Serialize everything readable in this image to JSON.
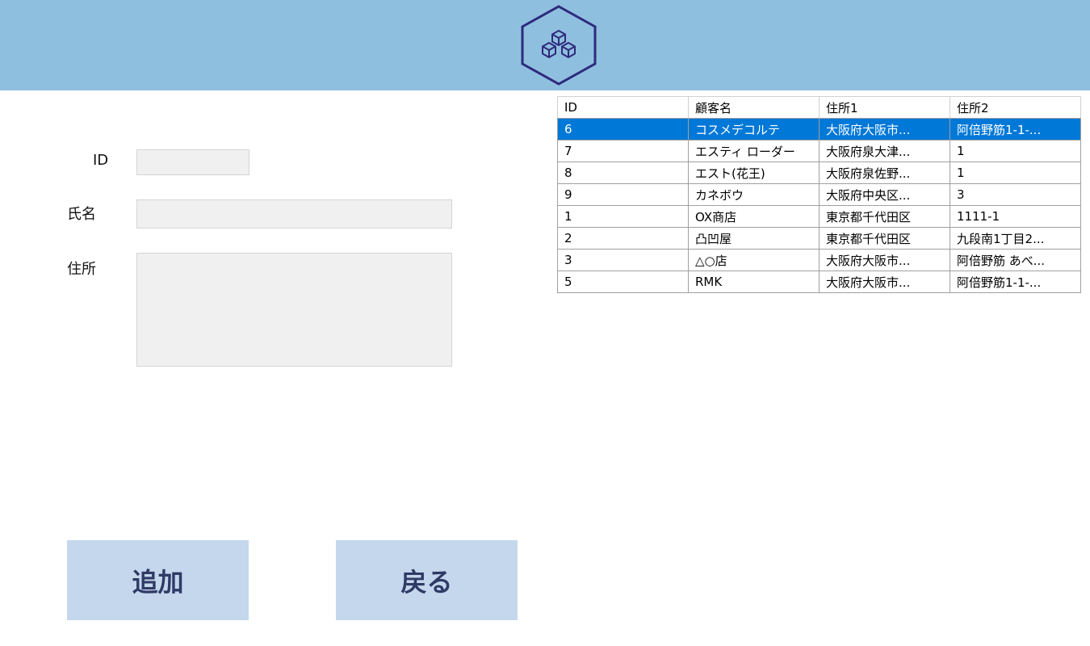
{
  "header": {
    "logo_icon": "cubes-hexagon-icon",
    "background_color": "#8fbfdf",
    "logo_color": "#2e2a7c"
  },
  "form": {
    "id_label": "ID",
    "id_value": "",
    "name_label": "氏名",
    "name_value": "",
    "address_label": "住所",
    "address_value": ""
  },
  "table": {
    "columns": [
      "ID",
      "顧客名",
      "住所1",
      "住所2"
    ],
    "selected_row_index": 0,
    "selection_color": "#0078d7",
    "rows": [
      [
        "6",
        "コスメデコルテ",
        "大阪府大阪市...",
        "阿倍野筋1-1-..."
      ],
      [
        "7",
        "エスティ ローダー",
        "大阪府泉大津...",
        "1"
      ],
      [
        "8",
        "エスト(花王)",
        "大阪府泉佐野...",
        "1"
      ],
      [
        "9",
        "カネボウ",
        "大阪府中央区...",
        "3"
      ],
      [
        "1",
        "OX商店",
        "東京都千代田区",
        "1111-1"
      ],
      [
        "2",
        "凸凹屋",
        "東京都千代田区",
        "九段南1丁目2..."
      ],
      [
        "3",
        "△○店",
        "大阪府大阪市...",
        "阿倍野筋 あべ..."
      ],
      [
        "5",
        "RMK",
        "大阪府大阪市...",
        "阿倍野筋1-1-..."
      ]
    ]
  },
  "buttons": {
    "add_label": "追加",
    "back_label": "戻る",
    "color": "#c4d7ec"
  }
}
